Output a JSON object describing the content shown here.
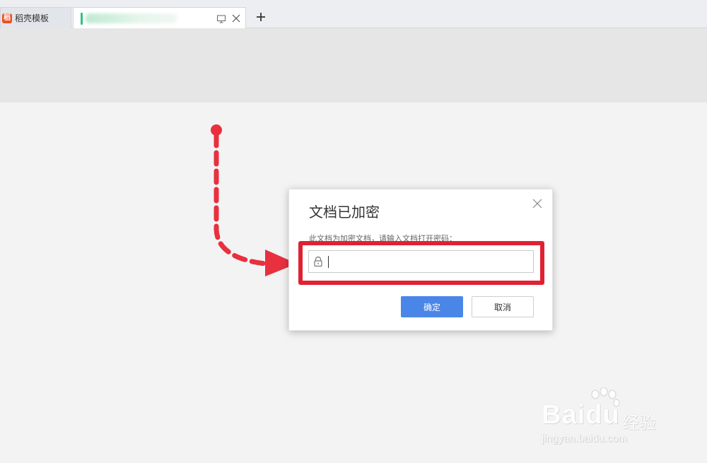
{
  "tabs": [
    {
      "label": "稻壳模板",
      "icon": "docer-logo-icon"
    },
    {
      "label": "",
      "icon": "document-icon"
    }
  ],
  "new_tab_label": "+",
  "dialog": {
    "title": "文档已加密",
    "prompt": "此文档为加密文档，请输入文档打开密码：",
    "password_value": "",
    "ok_label": "确定",
    "cancel_label": "取消"
  },
  "watermark": {
    "brand": "Baidu",
    "product": "经验",
    "url": "jingyan.baidu.com"
  },
  "colors": {
    "accent": "#4a86e8",
    "highlight": "#e02132",
    "arrow": "#e8303f",
    "brand_logo": "#f04e23"
  }
}
